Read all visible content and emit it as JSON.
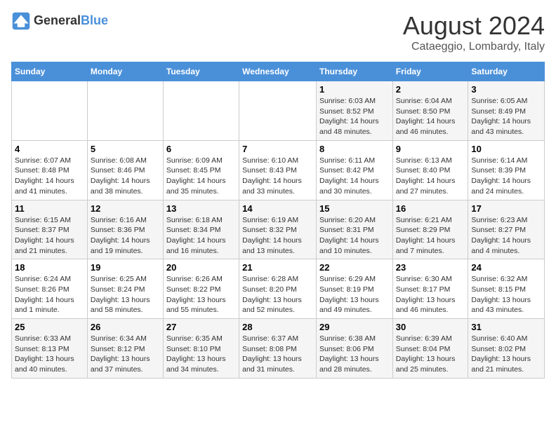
{
  "logo": {
    "line1": "General",
    "line2": "Blue"
  },
  "title": "August 2024",
  "subtitle": "Cataeggio, Lombardy, Italy",
  "days_header": [
    "Sunday",
    "Monday",
    "Tuesday",
    "Wednesday",
    "Thursday",
    "Friday",
    "Saturday"
  ],
  "weeks": [
    [
      {
        "day": "",
        "info": ""
      },
      {
        "day": "",
        "info": ""
      },
      {
        "day": "",
        "info": ""
      },
      {
        "day": "",
        "info": ""
      },
      {
        "day": "1",
        "info": "Sunrise: 6:03 AM\nSunset: 8:52 PM\nDaylight: 14 hours and 48 minutes."
      },
      {
        "day": "2",
        "info": "Sunrise: 6:04 AM\nSunset: 8:50 PM\nDaylight: 14 hours and 46 minutes."
      },
      {
        "day": "3",
        "info": "Sunrise: 6:05 AM\nSunset: 8:49 PM\nDaylight: 14 hours and 43 minutes."
      }
    ],
    [
      {
        "day": "4",
        "info": "Sunrise: 6:07 AM\nSunset: 8:48 PM\nDaylight: 14 hours and 41 minutes."
      },
      {
        "day": "5",
        "info": "Sunrise: 6:08 AM\nSunset: 8:46 PM\nDaylight: 14 hours and 38 minutes."
      },
      {
        "day": "6",
        "info": "Sunrise: 6:09 AM\nSunset: 8:45 PM\nDaylight: 14 hours and 35 minutes."
      },
      {
        "day": "7",
        "info": "Sunrise: 6:10 AM\nSunset: 8:43 PM\nDaylight: 14 hours and 33 minutes."
      },
      {
        "day": "8",
        "info": "Sunrise: 6:11 AM\nSunset: 8:42 PM\nDaylight: 14 hours and 30 minutes."
      },
      {
        "day": "9",
        "info": "Sunrise: 6:13 AM\nSunset: 8:40 PM\nDaylight: 14 hours and 27 minutes."
      },
      {
        "day": "10",
        "info": "Sunrise: 6:14 AM\nSunset: 8:39 PM\nDaylight: 14 hours and 24 minutes."
      }
    ],
    [
      {
        "day": "11",
        "info": "Sunrise: 6:15 AM\nSunset: 8:37 PM\nDaylight: 14 hours and 21 minutes."
      },
      {
        "day": "12",
        "info": "Sunrise: 6:16 AM\nSunset: 8:36 PM\nDaylight: 14 hours and 19 minutes."
      },
      {
        "day": "13",
        "info": "Sunrise: 6:18 AM\nSunset: 8:34 PM\nDaylight: 14 hours and 16 minutes."
      },
      {
        "day": "14",
        "info": "Sunrise: 6:19 AM\nSunset: 8:32 PM\nDaylight: 14 hours and 13 minutes."
      },
      {
        "day": "15",
        "info": "Sunrise: 6:20 AM\nSunset: 8:31 PM\nDaylight: 14 hours and 10 minutes."
      },
      {
        "day": "16",
        "info": "Sunrise: 6:21 AM\nSunset: 8:29 PM\nDaylight: 14 hours and 7 minutes."
      },
      {
        "day": "17",
        "info": "Sunrise: 6:23 AM\nSunset: 8:27 PM\nDaylight: 14 hours and 4 minutes."
      }
    ],
    [
      {
        "day": "18",
        "info": "Sunrise: 6:24 AM\nSunset: 8:26 PM\nDaylight: 14 hours and 1 minute."
      },
      {
        "day": "19",
        "info": "Sunrise: 6:25 AM\nSunset: 8:24 PM\nDaylight: 13 hours and 58 minutes."
      },
      {
        "day": "20",
        "info": "Sunrise: 6:26 AM\nSunset: 8:22 PM\nDaylight: 13 hours and 55 minutes."
      },
      {
        "day": "21",
        "info": "Sunrise: 6:28 AM\nSunset: 8:20 PM\nDaylight: 13 hours and 52 minutes."
      },
      {
        "day": "22",
        "info": "Sunrise: 6:29 AM\nSunset: 8:19 PM\nDaylight: 13 hours and 49 minutes."
      },
      {
        "day": "23",
        "info": "Sunrise: 6:30 AM\nSunset: 8:17 PM\nDaylight: 13 hours and 46 minutes."
      },
      {
        "day": "24",
        "info": "Sunrise: 6:32 AM\nSunset: 8:15 PM\nDaylight: 13 hours and 43 minutes."
      }
    ],
    [
      {
        "day": "25",
        "info": "Sunrise: 6:33 AM\nSunset: 8:13 PM\nDaylight: 13 hours and 40 minutes."
      },
      {
        "day": "26",
        "info": "Sunrise: 6:34 AM\nSunset: 8:12 PM\nDaylight: 13 hours and 37 minutes."
      },
      {
        "day": "27",
        "info": "Sunrise: 6:35 AM\nSunset: 8:10 PM\nDaylight: 13 hours and 34 minutes."
      },
      {
        "day": "28",
        "info": "Sunrise: 6:37 AM\nSunset: 8:08 PM\nDaylight: 13 hours and 31 minutes."
      },
      {
        "day": "29",
        "info": "Sunrise: 6:38 AM\nSunset: 8:06 PM\nDaylight: 13 hours and 28 minutes."
      },
      {
        "day": "30",
        "info": "Sunrise: 6:39 AM\nSunset: 8:04 PM\nDaylight: 13 hours and 25 minutes."
      },
      {
        "day": "31",
        "info": "Sunrise: 6:40 AM\nSunset: 8:02 PM\nDaylight: 13 hours and 21 minutes."
      }
    ]
  ]
}
